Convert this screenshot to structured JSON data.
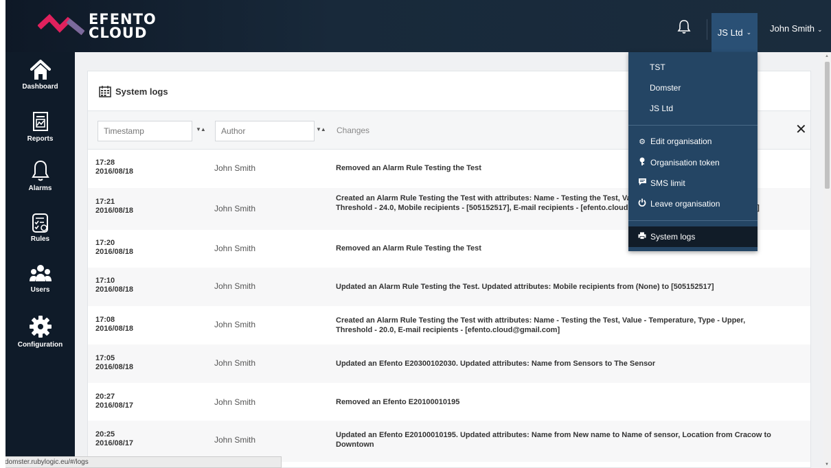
{
  "brand": {
    "line1": "EFENTO",
    "line2": "CLOUD",
    "accent": "#e0215d"
  },
  "topbar": {
    "organisation_button": "JS Ltd",
    "user_button": "John Smith"
  },
  "sidebar": {
    "items": [
      {
        "label": "Dashboard",
        "icon": "home-icon"
      },
      {
        "label": "Reports",
        "icon": "report-icon"
      },
      {
        "label": "Alarms",
        "icon": "bell-icon"
      },
      {
        "label": "Rules",
        "icon": "rules-icon"
      },
      {
        "label": "Users",
        "icon": "users-icon"
      },
      {
        "label": "Configuration",
        "icon": "gear-icon"
      }
    ]
  },
  "logs": {
    "title": "System logs",
    "filters": {
      "timestamp_placeholder": "Timestamp",
      "author_placeholder": "Author",
      "changes_header": "Changes"
    },
    "rows": [
      {
        "time": "17:28",
        "date": "2016/08/18",
        "author": "John Smith",
        "change": "Removed an Alarm Rule Testing the Test"
      },
      {
        "time": "17:21",
        "date": "2016/08/18",
        "author": "John Smith",
        "change": "Created an Alarm Rule Testing the Test with attributes: Name - Testing the Test, Value - Temperature, Type - Upper, Threshold - 24.0, Mobile recipients - [505152517], E-mail recipients - [efento.cloud@gmail.com, lolo_6@poczta.onet.pl]"
      },
      {
        "time": "17:20",
        "date": "2016/08/18",
        "author": "John Smith",
        "change": "Removed an Alarm Rule Testing the Test"
      },
      {
        "time": "17:10",
        "date": "2016/08/18",
        "author": "John Smith",
        "change": "Updated an Alarm Rule Testing the Test. Updated attributes: Mobile recipients from (None) to [505152517]"
      },
      {
        "time": "17:08",
        "date": "2016/08/18",
        "author": "John Smith",
        "change": "Created an Alarm Rule Testing the Test with attributes: Name - Testing the Test, Value - Temperature, Type - Upper, Threshold - 20.0, E-mail recipients - [efento.cloud@gmail.com]"
      },
      {
        "time": "17:05",
        "date": "2016/08/18",
        "author": "John Smith",
        "change": "Updated an Efento E20300102030. Updated attributes: Name from Sensors to The Sensor"
      },
      {
        "time": "20:27",
        "date": "2016/08/17",
        "author": "John Smith",
        "change": "Removed an Efento E20100010195"
      },
      {
        "time": "20:25",
        "date": "2016/08/17",
        "author": "John Smith",
        "change": "Updated an Efento E20100010195. Updated attributes: Name from New name to Name of sensor, Location from Cracow to Downtown"
      }
    ]
  },
  "org_dropdown": {
    "organisations": [
      "TST",
      "Domster",
      "JS Ltd"
    ],
    "actions": [
      {
        "label": "Edit organisation",
        "icon": "gear-icon"
      },
      {
        "label": "Organisation token",
        "icon": "key-icon"
      },
      {
        "label": "SMS limit",
        "icon": "message-icon"
      },
      {
        "label": "Leave organisation",
        "icon": "power-icon"
      }
    ],
    "system_logs": {
      "label": "System logs",
      "icon": "printer-icon"
    }
  },
  "status_url": "domster.rubylogic.eu/#/logs"
}
